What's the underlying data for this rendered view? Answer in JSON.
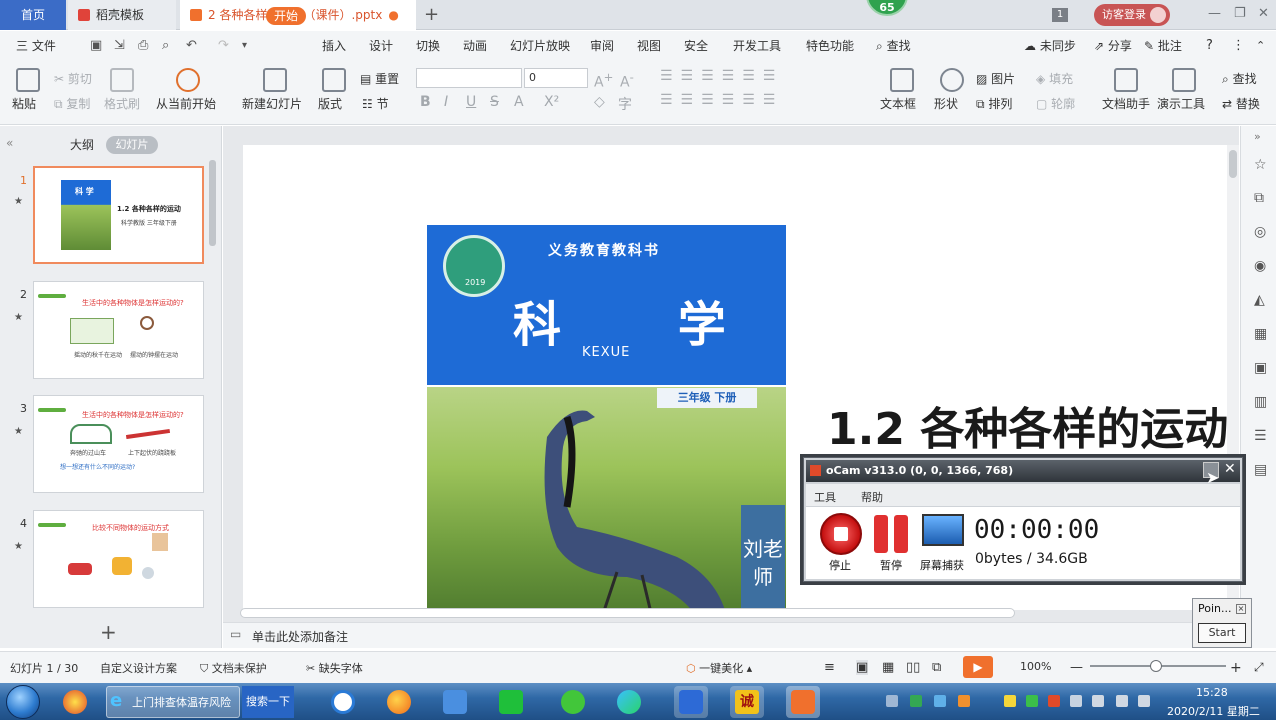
{
  "tabs": {
    "home": "首页",
    "template": "稻壳模板",
    "doc": "2 各种各样的运动（课件）.pptx",
    "badge": "65",
    "count": "1",
    "login": "访客登录"
  },
  "menu": {
    "file": "三 文件",
    "items": [
      "开始",
      "插入",
      "设计",
      "切换",
      "动画",
      "幻灯片放映",
      "审阅",
      "视图",
      "安全",
      "开发工具",
      "特色功能"
    ],
    "search": "查找",
    "sync": "未同步",
    "share": "分享",
    "annotate": "批注"
  },
  "ribbon": {
    "paste": "粘贴",
    "cut": "剪切",
    "copy": "复制",
    "format_painter": "格式刷",
    "from_current": "从当前开始",
    "new_slide": "新建幻灯片",
    "layout": "版式",
    "reset": "重置",
    "section": "节",
    "font_size": "0",
    "textbox": "文本框",
    "shape": "形状",
    "picture": "图片",
    "fill": "填充",
    "arrange": "排列",
    "outline": "轮廓",
    "doc_helper": "文档助手",
    "present_tools": "演示工具",
    "find": "查找",
    "replace": "替换"
  },
  "left": {
    "outline_tab": "大纲",
    "slides_tab": "幻灯片",
    "thumbs": [
      {
        "num": "1",
        "title": "1.2 各种各样的运动",
        "caption": "科学教版 三年级下册",
        "book": "科 学"
      },
      {
        "num": "2",
        "title": "生活中的各种物体是怎样运动的?",
        "cap1": "摇动的秋千在运动",
        "cap2": "摆动的钟摆在运动"
      },
      {
        "num": "3",
        "title": "生活中的各种物体是怎样运动的?",
        "cap1": "奔驰的过山车",
        "cap2": "上下起伏的跷跷板",
        "note": "想一想还有什么不同的运动?"
      },
      {
        "num": "4",
        "title": "比较不同物体的运动方式"
      }
    ]
  },
  "slide": {
    "cover_header": "义务教育教科书",
    "cover_subject": "科 学",
    "cover_kexue": "KEXUE",
    "cover_grade": "三年级 下册",
    "cover_teacher": "刘老师",
    "seal_year": "2019",
    "title": "1.2 各种各样的运动"
  },
  "notes": "单击此处添加备注",
  "status": {
    "slide_index": "幻灯片 1 / 30",
    "design": "自定义设计方案",
    "protect": "文档未保护",
    "font_missing": "缺失字体",
    "beautify": "一键美化",
    "zoom": "100%"
  },
  "ocam": {
    "title": "oCam v313.0 (0, 0, 1366, 768)",
    "menu_tools": "工具",
    "menu_help": "帮助",
    "time": "00:00:00",
    "size": "0bytes / 34.6GB",
    "stop": "停止",
    "pause": "暂停",
    "capture": "屏幕捕获"
  },
  "pointer": {
    "title": "Poin...",
    "start": "Start"
  },
  "taskbar": {
    "ie_text": "上门排查体温存风险",
    "search": "搜索一下",
    "time": "15:28",
    "date": "2020/2/11 星期二"
  }
}
